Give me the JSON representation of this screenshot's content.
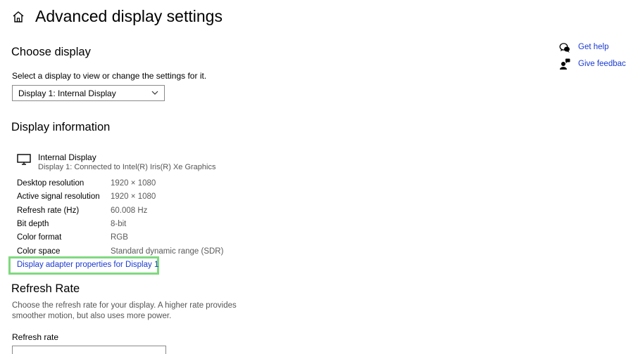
{
  "header": {
    "title": "Advanced display settings",
    "home_icon": "home-icon"
  },
  "choose_display": {
    "heading": "Choose display",
    "instruction": "Select a display to view or change the settings for it.",
    "selected": "Display 1: Internal Display",
    "chevron_icon": "chevron-down-icon"
  },
  "display_info": {
    "heading": "Display information",
    "monitor_icon": "monitor-icon",
    "display_name": "Internal Display",
    "connection": "Display 1: Connected to Intel(R) Iris(R) Xe Graphics",
    "rows": [
      {
        "label": "Desktop resolution",
        "value": "1920 × 1080"
      },
      {
        "label": "Active signal resolution",
        "value": "1920 × 1080"
      },
      {
        "label": "Refresh rate (Hz)",
        "value": "60.008 Hz"
      },
      {
        "label": "Bit depth",
        "value": "8-bit"
      },
      {
        "label": "Color format",
        "value": "RGB"
      },
      {
        "label": "Color space",
        "value": "Standard dynamic range (SDR)"
      }
    ],
    "adapter_link": "Display adapter properties for Display 1"
  },
  "refresh_rate": {
    "heading": "Refresh Rate",
    "description": "Choose the refresh rate for your display. A higher rate provides smoother motion, but also uses more power.",
    "field_label": "Refresh rate"
  },
  "side_links": {
    "get_help": "Get help",
    "give_feedback": "Give feedback"
  },
  "colors": {
    "link": "#1a3ad0",
    "highlight": "#7fd97f"
  }
}
